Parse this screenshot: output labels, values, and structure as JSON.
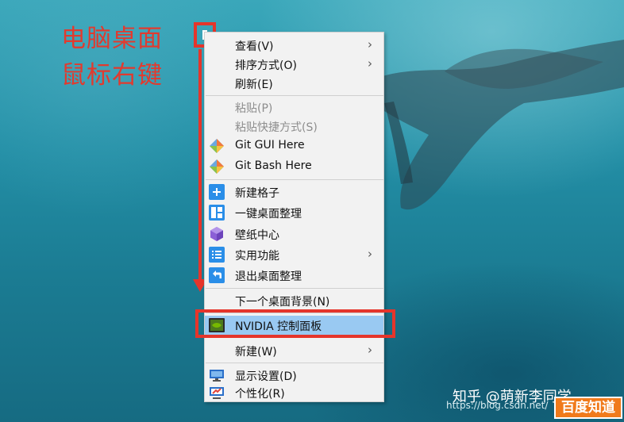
{
  "annotation": {
    "line1": "电脑桌面",
    "line2": "鼠标右键",
    "color": "#e5352b"
  },
  "menu": {
    "items": [
      {
        "id": "view",
        "label": "查看(V)",
        "submenu": true,
        "enabled": true
      },
      {
        "id": "sort",
        "label": "排序方式(O)",
        "submenu": true,
        "enabled": true
      },
      {
        "id": "refresh",
        "label": "刷新(E)",
        "submenu": false,
        "enabled": true
      },
      {
        "id": "paste",
        "label": "粘贴(P)",
        "submenu": false,
        "enabled": false
      },
      {
        "id": "paste-shortcut",
        "label": "粘贴快捷方式(S)",
        "submenu": false,
        "enabled": false
      },
      {
        "id": "git-gui",
        "label": "Git GUI Here",
        "icon": "git-icon",
        "submenu": false,
        "enabled": true
      },
      {
        "id": "git-bash",
        "label": "Git Bash Here",
        "icon": "git-icon",
        "submenu": false,
        "enabled": true
      },
      {
        "id": "new-grid",
        "label": "新建格子",
        "icon": "plus-icon",
        "submenu": false,
        "enabled": true
      },
      {
        "id": "organize-desktop",
        "label": "一键桌面整理",
        "icon": "layout-icon",
        "submenu": false,
        "enabled": true
      },
      {
        "id": "wallpaper-center",
        "label": "壁纸中心",
        "icon": "cube-icon",
        "submenu": false,
        "enabled": true
      },
      {
        "id": "utilities",
        "label": "实用功能",
        "icon": "list-icon",
        "submenu": true,
        "enabled": true
      },
      {
        "id": "exit-organize",
        "label": "退出桌面整理",
        "icon": "undo-icon",
        "submenu": false,
        "enabled": true
      },
      {
        "id": "next-background",
        "label": "下一个桌面背景(N)",
        "submenu": false,
        "enabled": true
      },
      {
        "id": "nvidia",
        "label": "NVIDIA 控制面板",
        "icon": "nvidia-icon",
        "submenu": false,
        "enabled": true,
        "highlighted": true
      },
      {
        "id": "new",
        "label": "新建(W)",
        "submenu": true,
        "enabled": true
      },
      {
        "id": "display-settings",
        "label": "显示设置(D)",
        "icon": "monitor-icon",
        "submenu": false,
        "enabled": true
      },
      {
        "id": "personalize",
        "label": "个性化(R)",
        "icon": "personalize-icon",
        "submenu": false,
        "enabled": true
      }
    ],
    "submenu_arrow": "›",
    "highlight_color": "#99c9f2"
  },
  "watermark": {
    "zhihu": "知乎 @萌新李同学",
    "url": "https://blog.csdn.net/",
    "baidu": "百度知道"
  }
}
